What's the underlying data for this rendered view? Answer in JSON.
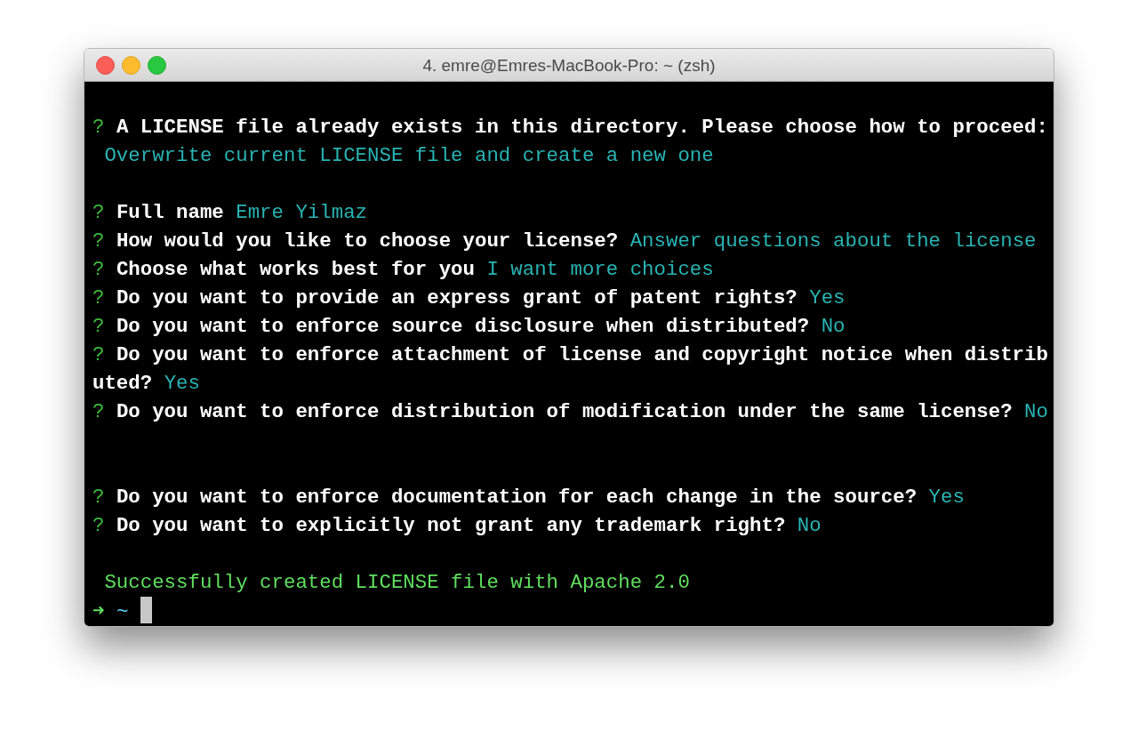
{
  "window": {
    "title": "4. emre@Emres-MacBook-Pro: ~ (zsh)"
  },
  "lines": [
    {
      "kind": "blank"
    },
    {
      "kind": "prompt",
      "mark": "?",
      "question": "A LICENSE file already exists in this directory. Please choose how to proceed:"
    },
    {
      "kind": "answer",
      "answer": " Overwrite current LICENSE file and create a new one"
    },
    {
      "kind": "blank"
    },
    {
      "kind": "prompt",
      "mark": "?",
      "question": "Full name",
      "answer": "Emre Yilmaz"
    },
    {
      "kind": "prompt",
      "mark": "?",
      "question": "How would you like to choose your license?",
      "answer": "Answer questions about the license"
    },
    {
      "kind": "prompt",
      "mark": "?",
      "question": "Choose what works best for you",
      "answer": "I want more choices"
    },
    {
      "kind": "prompt",
      "mark": "?",
      "question": "Do you want to provide an express grant of patent rights?",
      "answer": "Yes"
    },
    {
      "kind": "prompt",
      "mark": "?",
      "question": "Do you want to enforce source disclosure when distributed?",
      "answer": "No"
    },
    {
      "kind": "prompt",
      "mark": "?",
      "question": "Do you want to enforce attachment of license and copyright notice when distributed?",
      "answer": "Yes"
    },
    {
      "kind": "prompt",
      "mark": "?",
      "question": "Do you want to enforce distribution of modification under the same license?",
      "answer": "No"
    },
    {
      "kind": "blank"
    },
    {
      "kind": "blank"
    },
    {
      "kind": "prompt",
      "mark": "?",
      "question": "Do you want to enforce documentation for each change in the source?",
      "answer": "Yes"
    },
    {
      "kind": "prompt",
      "mark": "?",
      "question": "Do you want to explicitly not grant any trademark right?",
      "answer": "No"
    },
    {
      "kind": "blank"
    },
    {
      "kind": "success",
      "text": "Successfully created LICENSE file with Apache 2.0"
    },
    {
      "kind": "shell",
      "arrow": "➜",
      "cwd": "~"
    }
  ]
}
